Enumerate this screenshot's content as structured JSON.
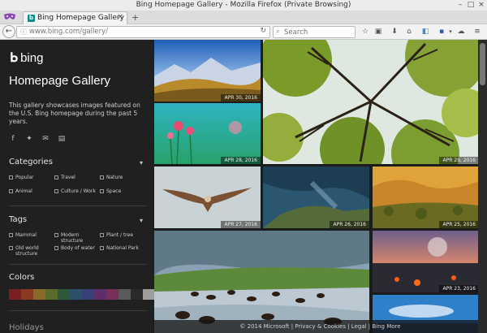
{
  "window": {
    "title": "Bing Homepage Gallery - Mozilla Firefox (Private Browsing)"
  },
  "tab": {
    "favicon": "b",
    "label": "Bing Homepage Gallery",
    "close": "×",
    "new_tab": "+"
  },
  "nav": {
    "url": "www.bing.com/gallery/",
    "search_placeholder": "Search",
    "icons": [
      "back-icon",
      "info-icon",
      "reload-icon",
      "search-icon",
      "star-icon",
      "clipboard-icon",
      "download-icon",
      "home-icon",
      "pocket-icon",
      "save-icon",
      "sync-icon",
      "menu-icon"
    ]
  },
  "sidebar": {
    "logo_text": "bing",
    "title": "Homepage Gallery",
    "description": "This gallery showcases images featured on the U.S. Bing homepage during the past 5 years.",
    "categories_heading": "Categories",
    "categories": [
      "Popular",
      "Travel",
      "Nature",
      "Animal",
      "Culture / Work",
      "Space"
    ],
    "tags_heading": "Tags",
    "tags": [
      "Mammal",
      "Modern structure",
      "Plant / tree",
      "Old world structure",
      "Body of water",
      "National Park"
    ],
    "colors_heading": "Colors",
    "colors": [
      "#7b1f23",
      "#8a3a22",
      "#8a6a2a",
      "#5a6b2b",
      "#2d5a3a",
      "#2c4f6a",
      "#3b3f78",
      "#5d2f6a",
      "#7a2f5a",
      "#5a5a5a",
      "#2a2a2a",
      "#9e9e9e"
    ],
    "holidays_heading": "Holidays"
  },
  "gallery": {
    "dates": [
      "APR 30, 2016",
      "APR 29, 2016",
      "APR 28, 2016",
      "APR 27, 2016",
      "APR 26, 2016",
      "APR 25, 2016",
      "APR 23, 2016"
    ]
  },
  "footer": {
    "text": "© 2014 Microsoft | Privacy & Cookies | Legal | Bing More"
  }
}
